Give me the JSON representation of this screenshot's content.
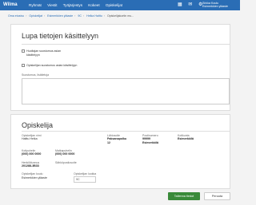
{
  "header": {
    "logo": "Wilma",
    "nav": [
      "Ryhmät",
      "Viestit",
      "Työjärjestys",
      "Kokeet",
      "Opiskelijat"
    ],
    "icons": [
      "grid-icon",
      "bell-icon",
      "gear-icon"
    ],
    "user_line1": "Sirkka Koulu",
    "user_line2": "Esimerkkien yläaste"
  },
  "breadcrumb": [
    "Oma etusivu",
    "Opiskelijat",
    "Esimerkkien yläaste",
    "9C",
    "Helka Halttu",
    "Opiskelijakortin mu..."
  ],
  "consent": {
    "title": "Lupa tietojen käsittelyyn",
    "opt1": "Huoltajan suostumus asian käsittelyyn",
    "opt2": "Opiskelijan suostumus asian käsittelyyn",
    "notes_label": "Suostumus, lisätietoja"
  },
  "student": {
    "title": "Opiskelija",
    "name_label": "Opiskelijan nimi",
    "name": "Halttu Helka",
    "address_label": "Lähiosoite",
    "address_line1": "Paksanapolku",
    "address_line2": "12",
    "postal_label": "Postinumero",
    "postal": "99999",
    "city_label": "Kotikunta",
    "city_postal": "Esimerkkilä",
    "city": "Esimerkkilä",
    "home_phone_label": "Kotipuhelin",
    "home_phone": "(000) 000 0000",
    "mobile_label": "Matkapuhelin",
    "mobile": "(000) 000 0000",
    "ssn_label": "Henkilötunnus",
    "ssn": "201288-3B33",
    "email_label": "Sähköpostiosoite",
    "school_label": "Opiskelijan koulu",
    "school": "Esimerkkien yläaste",
    "class_label": "Opiskelijan luokka",
    "class": "9C"
  },
  "actions": {
    "save": "Tallenna tiedot",
    "cancel": "Peruuta"
  },
  "colors": {
    "topbar": "#2a6db5",
    "save": "#3a8a3a"
  }
}
